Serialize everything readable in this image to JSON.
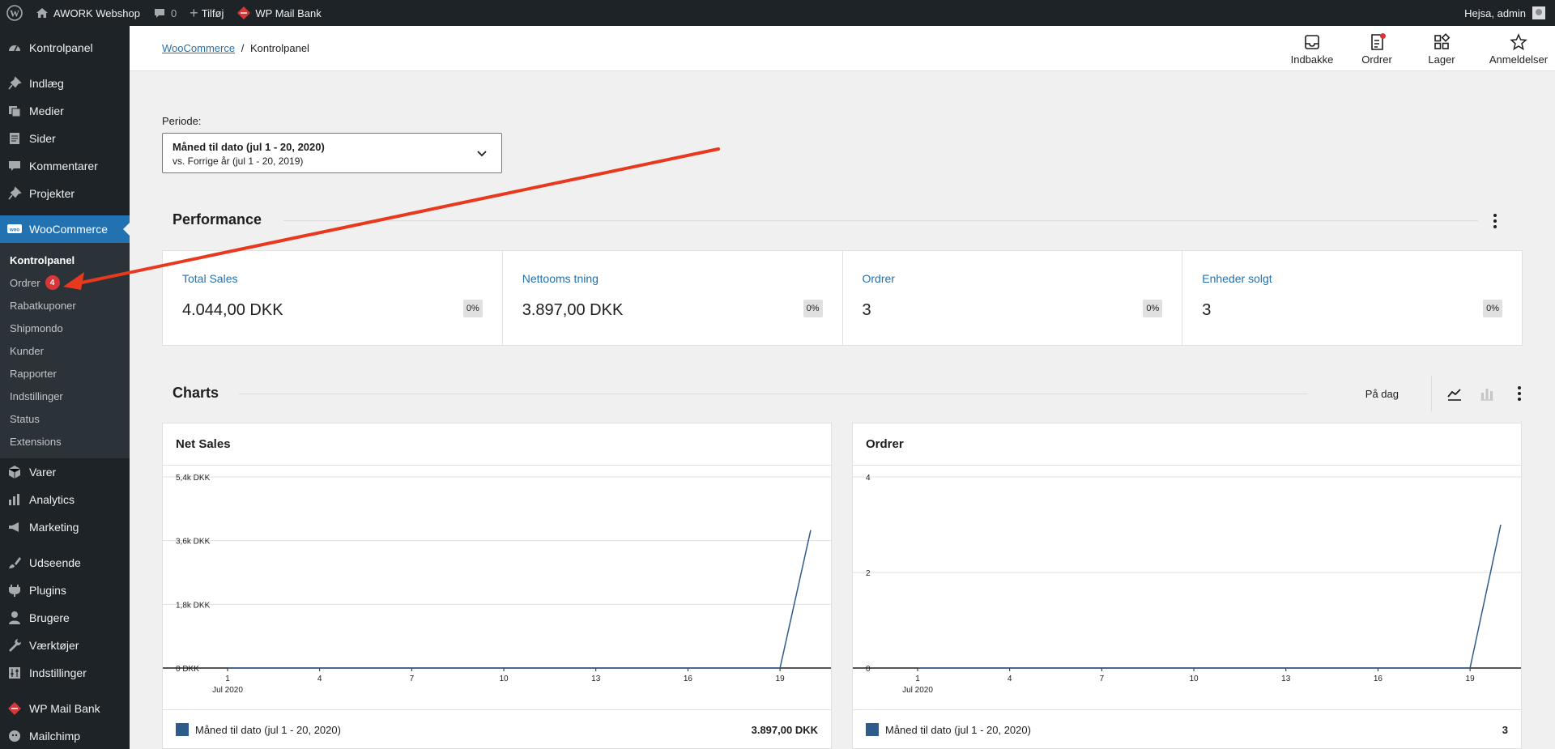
{
  "adminbar": {
    "site_name": "AWORK Webshop",
    "comments_count": "0",
    "new_label": "Tilføj",
    "plugin_label": "WP Mail Bank",
    "greeting": "Hejsa, admin"
  },
  "sidebar": {
    "top_items": [
      {
        "label": "Kontrolpanel",
        "icon": "dashboard-icon"
      },
      {
        "label": "Indlæg",
        "icon": "pin-icon"
      },
      {
        "label": "Medier",
        "icon": "media-icon"
      },
      {
        "label": "Sider",
        "icon": "page-icon"
      },
      {
        "label": "Kommentarer",
        "icon": "comment-icon"
      },
      {
        "label": "Projekter",
        "icon": "pin-icon"
      }
    ],
    "woocommerce": {
      "label": "WooCommerce",
      "icon": "woo-icon"
    },
    "submenu": [
      {
        "label": "Kontrolpanel"
      },
      {
        "label": "Ordrer",
        "badge": "4"
      },
      {
        "label": "Rabatkuponer"
      },
      {
        "label": "Shipmondo"
      },
      {
        "label": "Kunder"
      },
      {
        "label": "Rapporter"
      },
      {
        "label": "Indstillinger"
      },
      {
        "label": "Status"
      },
      {
        "label": "Extensions"
      }
    ],
    "group2": [
      {
        "label": "Varer",
        "icon": "box-icon"
      },
      {
        "label": "Analytics",
        "icon": "bar-chart-icon"
      },
      {
        "label": "Marketing",
        "icon": "megaphone-icon"
      }
    ],
    "group3": [
      {
        "label": "Udseende",
        "icon": "brush-icon"
      },
      {
        "label": "Plugins",
        "icon": "plug-icon"
      },
      {
        "label": "Brugere",
        "icon": "user-icon"
      },
      {
        "label": "Værktøjer",
        "icon": "wrench-icon"
      },
      {
        "label": "Indstillinger",
        "icon": "settings-icon"
      }
    ],
    "group4": [
      {
        "label": "WP Mail Bank",
        "icon": "mail-bank-icon"
      },
      {
        "label": "Mailchimp",
        "icon": "mailchimp-icon"
      }
    ]
  },
  "header": {
    "breadcrumb_link": "WooCommerce",
    "breadcrumb_sep": "/",
    "breadcrumb_current": "Kontrolpanel",
    "actions": [
      {
        "label": "Indbakke",
        "icon": "inbox-icon"
      },
      {
        "label": "Ordrer",
        "icon": "orders-icon"
      },
      {
        "label": "Lager",
        "icon": "stock-icon"
      },
      {
        "label": "Anmeldelser",
        "icon": "star-icon"
      }
    ]
  },
  "periode": {
    "label": "Periode:",
    "main": "Måned til dato (jul 1 - 20, 2020)",
    "compare": "vs. Forrige år (jul 1 - 20, 2019)"
  },
  "performance": {
    "title": "Performance",
    "cards": [
      {
        "label": "Total Sales",
        "value": "4.044,00 DKK",
        "delta": "0%"
      },
      {
        "label": "Nettooms tning",
        "value": "3.897,00 DKK",
        "delta": "0%"
      },
      {
        "label": "Ordrer",
        "value": "3",
        "delta": "0%"
      },
      {
        "label": "Enheder solgt",
        "value": "3",
        "delta": "0%"
      }
    ]
  },
  "charts": {
    "title": "Charts",
    "interval": "På dag",
    "legend_label": "Måned til dato (jul 1 - 20, 2020)"
  },
  "chart_data": [
    {
      "type": "line",
      "title": "Net Sales",
      "x": [
        1,
        2,
        3,
        4,
        5,
        6,
        7,
        8,
        9,
        10,
        11,
        12,
        13,
        14,
        15,
        16,
        17,
        18,
        19,
        20
      ],
      "x_ticks": [
        "1",
        "4",
        "7",
        "10",
        "13",
        "16",
        "19"
      ],
      "x_sub": "Jul 2020",
      "y_ticks": [
        "0 DKK",
        "1,8k DKK",
        "3,6k DKK",
        "5,4k DKK"
      ],
      "ylim": [
        0,
        5400
      ],
      "series": [
        {
          "values": [
            0,
            0,
            0,
            0,
            0,
            0,
            0,
            0,
            0,
            0,
            0,
            0,
            0,
            0,
            0,
            0,
            0,
            0,
            0,
            3897
          ],
          "color": "#2e5c8a"
        }
      ],
      "legend_total": "3.897,00 DKK"
    },
    {
      "type": "line",
      "title": "Ordrer",
      "x": [
        1,
        2,
        3,
        4,
        5,
        6,
        7,
        8,
        9,
        10,
        11,
        12,
        13,
        14,
        15,
        16,
        17,
        18,
        19,
        20
      ],
      "x_ticks": [
        "1",
        "4",
        "7",
        "10",
        "13",
        "16",
        "19"
      ],
      "x_sub": "Jul 2020",
      "y_ticks": [
        "0",
        "2",
        "4"
      ],
      "ylim": [
        0,
        4
      ],
      "series": [
        {
          "values": [
            0,
            0,
            0,
            0,
            0,
            0,
            0,
            0,
            0,
            0,
            0,
            0,
            0,
            0,
            0,
            0,
            0,
            0,
            0,
            3
          ],
          "color": "#2e5c8a"
        }
      ],
      "legend_total": "3"
    }
  ],
  "colors": {
    "accent": "#2271b1",
    "admin_dark": "#1d2327",
    "annotation": "#e8391f"
  }
}
